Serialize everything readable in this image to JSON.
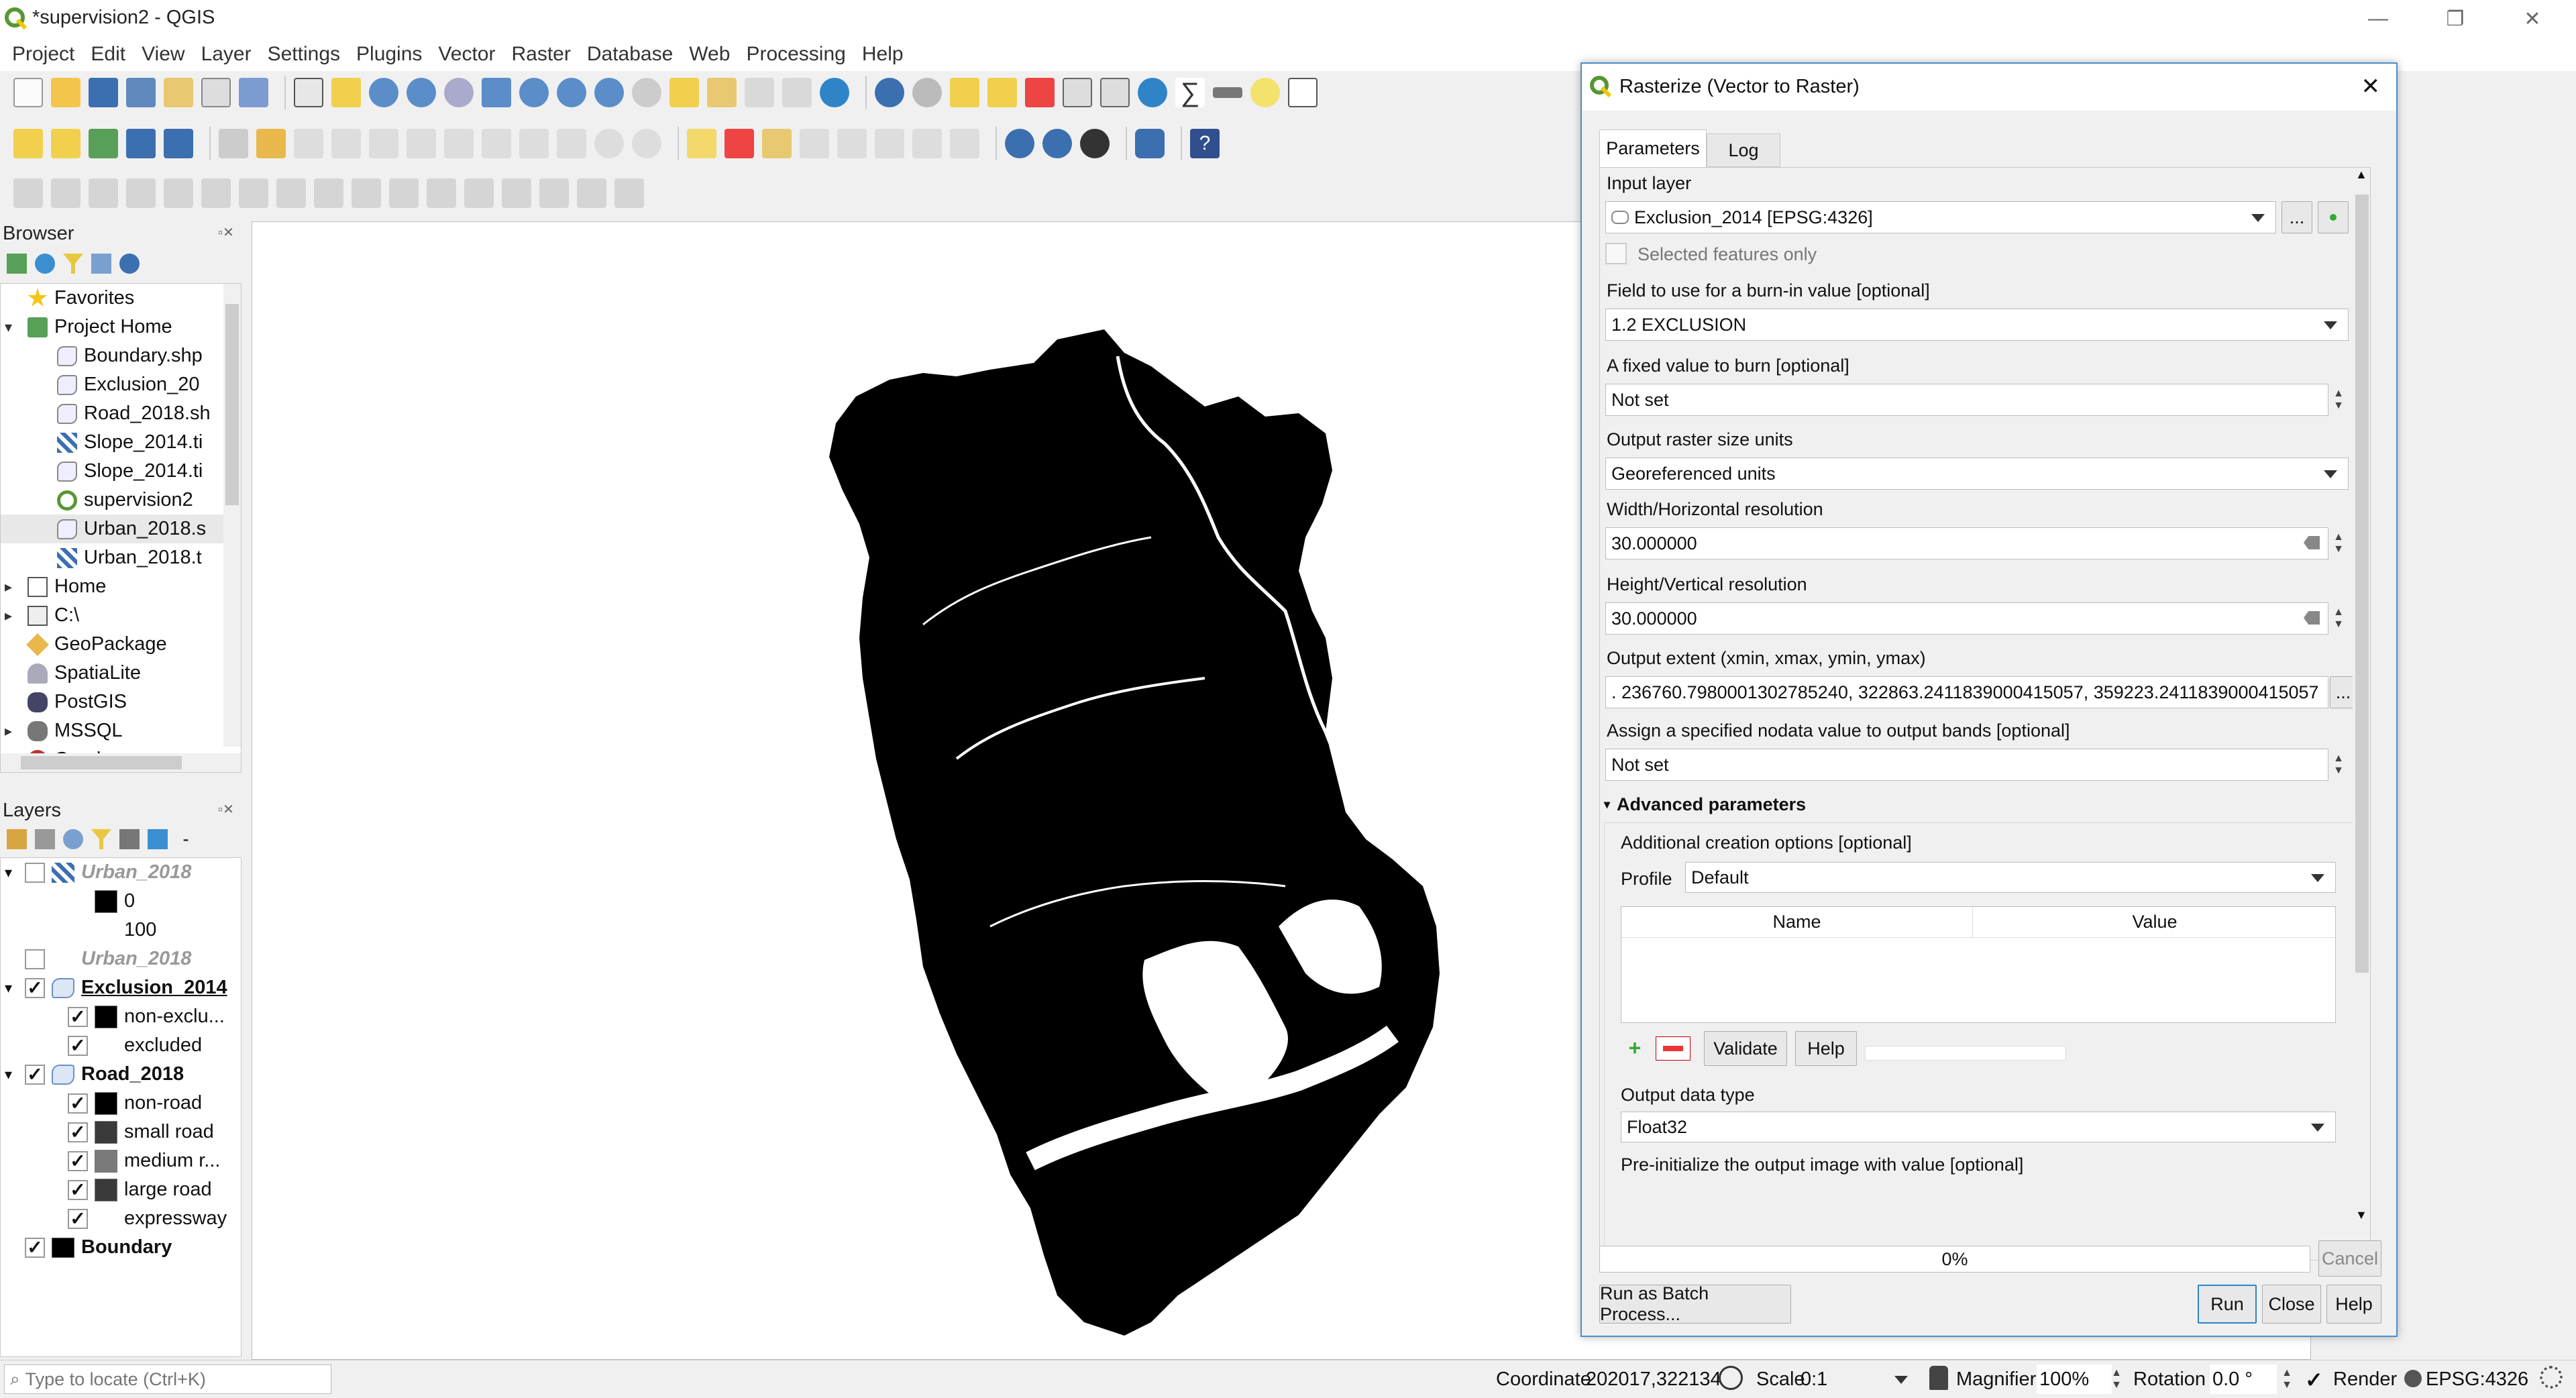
{
  "window": {
    "title": "*supervision2 - QGIS",
    "minimize": "—",
    "restore": "❐",
    "close": "✕"
  },
  "menu": [
    "Project",
    "Edit",
    "View",
    "Layer",
    "Settings",
    "Plugins",
    "Vector",
    "Raster",
    "Database",
    "Web",
    "Processing",
    "Help"
  ],
  "browser": {
    "title": "Browser",
    "items": [
      {
        "label": "Favorites",
        "level": 0,
        "expander": "",
        "icon": "star-icon"
      },
      {
        "label": "Project Home",
        "level": 0,
        "expander": "▾",
        "icon": "folder-green-icon"
      },
      {
        "label": "Boundary.shp",
        "level": 1,
        "expander": "",
        "icon": "polygon-layer-icon"
      },
      {
        "label": "Exclusion_20",
        "level": 1,
        "expander": "",
        "icon": "polygon-layer-icon"
      },
      {
        "label": "Road_2018.sh",
        "level": 1,
        "expander": "",
        "icon": "polygon-layer-icon"
      },
      {
        "label": "Slope_2014.ti",
        "level": 1,
        "expander": "",
        "icon": "raster-layer-icon"
      },
      {
        "label": "Slope_2014.ti",
        "level": 1,
        "expander": "",
        "icon": "polygon-layer-icon"
      },
      {
        "label": "supervision2",
        "level": 1,
        "expander": "",
        "icon": "qgis-icon"
      },
      {
        "label": "Urban_2018.s",
        "level": 1,
        "expander": "",
        "icon": "polygon-layer-icon"
      },
      {
        "label": "Urban_2018.t",
        "level": 1,
        "expander": "",
        "icon": "raster-layer-icon"
      },
      {
        "label": "Home",
        "level": 0,
        "expander": "▸",
        "icon": "home-icon"
      },
      {
        "label": "C:\\",
        "level": 0,
        "expander": "▸",
        "icon": "drive-icon"
      },
      {
        "label": "GeoPackage",
        "level": 0,
        "expander": "",
        "icon": "geopackage-icon"
      },
      {
        "label": "SpatiaLite",
        "level": 0,
        "expander": "",
        "icon": "spatialite-icon"
      },
      {
        "label": "PostGIS",
        "level": 0,
        "expander": "",
        "icon": "postgis-icon"
      },
      {
        "label": "MSSQL",
        "level": 0,
        "expander": "▸",
        "icon": "mssql-icon"
      },
      {
        "label": "Oracle",
        "level": 0,
        "expander": "▸",
        "icon": "oracle-icon"
      }
    ]
  },
  "layers": {
    "title": "Layers",
    "items": [
      {
        "label": "Urban_2018",
        "kind": "group-raster",
        "checked": false,
        "expander": "▾",
        "style": "italic-grey"
      },
      {
        "label": "0",
        "kind": "legend",
        "swatch": "#000000",
        "checked": null
      },
      {
        "label": "100",
        "kind": "legend",
        "swatch": "#ffffff",
        "checked": null
      },
      {
        "label": "Urban_2018",
        "kind": "layer",
        "checked": false,
        "expander": "",
        "style": "italic-grey"
      },
      {
        "label": "Exclusion_2014",
        "kind": "group-vector",
        "checked": true,
        "expander": "▾",
        "style": "bold-underline"
      },
      {
        "label": "non-exclu...",
        "kind": "legend-check",
        "swatch": "#000000",
        "checked": true
      },
      {
        "label": "excluded",
        "kind": "legend-check",
        "swatch": "#ffffff",
        "checked": true
      },
      {
        "label": "Road_2018",
        "kind": "group-vector",
        "checked": true,
        "expander": "▾",
        "style": "bold"
      },
      {
        "label": "non-road",
        "kind": "legend-check",
        "swatch": "#000000",
        "checked": true
      },
      {
        "label": "small road",
        "kind": "legend-check",
        "swatch": "#3a3a3a",
        "checked": true
      },
      {
        "label": "medium r...",
        "kind": "legend-check",
        "swatch": "#7a7a7a",
        "checked": true
      },
      {
        "label": "large road",
        "kind": "legend-check",
        "swatch": "#3a3a3a",
        "checked": true
      },
      {
        "label": "expressway",
        "kind": "legend-check",
        "swatch": "#ffffff",
        "checked": true
      },
      {
        "label": "Boundary",
        "kind": "layer-vector",
        "checked": true,
        "expander": "",
        "style": "bold",
        "swatch": "#000000"
      }
    ]
  },
  "dialog": {
    "title": "Rasterize (Vector to Raster)",
    "tabs": [
      "Parameters",
      "Log"
    ],
    "input_layer_label": "Input layer",
    "input_layer_value": "Exclusion_2014 [EPSG:4326]",
    "selected_only_label": "Selected features only",
    "field_label": "Field to use for a burn-in value [optional]",
    "field_value": "1.2 EXCLUSION",
    "fixed_label": "A fixed value to burn [optional]",
    "fixed_value": "Not set",
    "units_label": "Output raster size units",
    "units_value": "Georeferenced units",
    "width_label": "Width/Horizontal resolution",
    "width_value": "30.000000",
    "height_label": "Height/Vertical resolution",
    "height_value": "30.000000",
    "extent_label": "Output extent (xmin, xmax, ymin, ymax)",
    "extent_value": ". 236760.7980001302785240, 322863.2411839000415057, 359223.2411839000415057",
    "nodata_label": "Assign a specified nodata value to output bands [optional]",
    "nodata_value": "Not set",
    "advanced_label": "Advanced parameters",
    "creation_label": "Additional creation options [optional]",
    "profile_label": "Profile",
    "profile_value": "Default",
    "table_headers": [
      "Name",
      "Value"
    ],
    "validate_label": "Validate",
    "help_small_label": "Help",
    "datatype_label": "Output data type",
    "datatype_value": "Float32",
    "preinit_label": "Pre-initialize the output image with value [optional]",
    "progress_text": "0%",
    "cancel_label": "Cancel",
    "batch_label": "Run as Batch Process...",
    "run_label": "Run",
    "close_label": "Close",
    "help_label": "Help",
    "ellipsis": "..."
  },
  "statusbar": {
    "locate_placeholder": "Type to locate (Ctrl+K)",
    "coordinate_label": "Coordinate",
    "coordinate_value": "202017,322134",
    "scale_label": "Scale",
    "scale_value": "0:1",
    "magnifier_label": "Magnifier",
    "magnifier_value": "100%",
    "rotation_label": "Rotation",
    "rotation_value": "0.0 °",
    "render_label": "Render",
    "crs_label": "EPSG:4326"
  },
  "colors": {
    "accent": "#4a90c8",
    "map_fill": "#000000",
    "qgis_green": "#589632"
  }
}
